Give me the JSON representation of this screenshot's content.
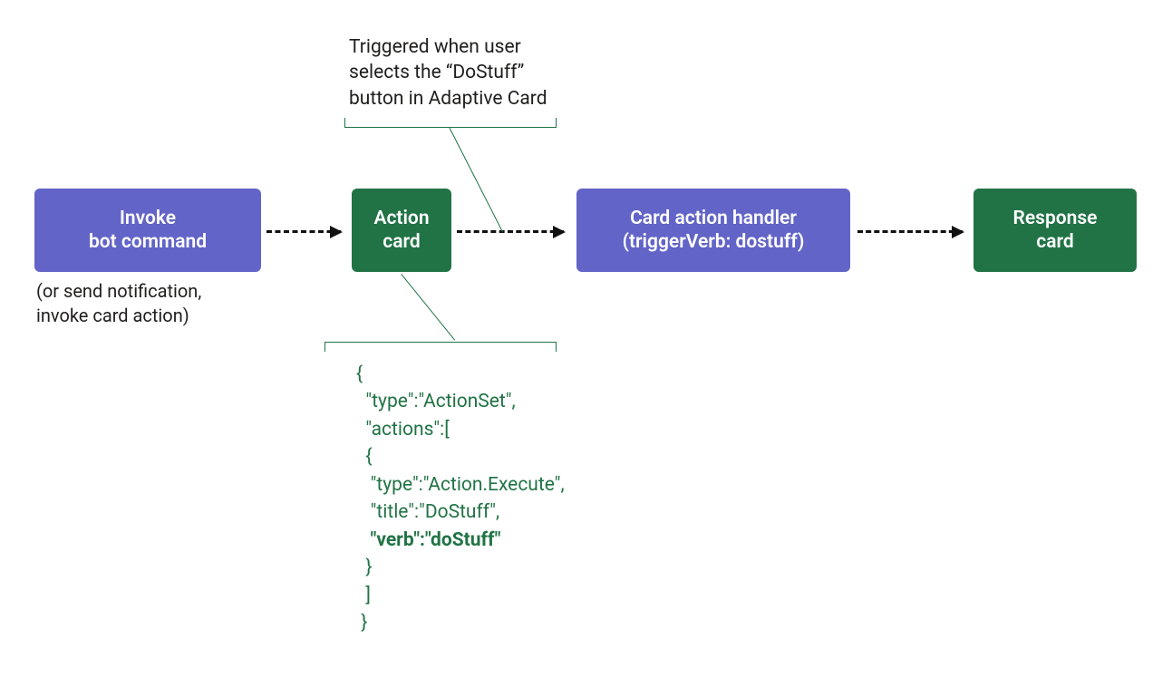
{
  "nodes": {
    "invoke": {
      "line1": "Invoke",
      "line2": "bot command"
    },
    "action": {
      "line1": "Action",
      "line2": "card"
    },
    "handler": {
      "line1": "Card action handler",
      "line2": "(triggerVerb: dostuff)"
    },
    "response": {
      "line1": "Response",
      "line2": "card"
    }
  },
  "invoke_sub": "(or send notification,\ninvoke card action)",
  "annotation_top": "Triggered when user\nselects the “DoStuff”\nbutton in Adaptive Card",
  "code": {
    "l1": "{",
    "l2": "  \"type\":\"ActionSet\",",
    "l3": "  \"actions\":[",
    "l4": "  {",
    "l5": "   \"type\":\"Action.Execute\",",
    "l6": "   \"title\":\"DoStuff\",",
    "l7_prefix": "   ",
    "l7_bold": "\"verb\":\"doStuff\"",
    "l8": "  }",
    "l9": "  ]",
    "l10": " }"
  },
  "colors": {
    "purple": "#6264c7",
    "green": "#217346"
  }
}
